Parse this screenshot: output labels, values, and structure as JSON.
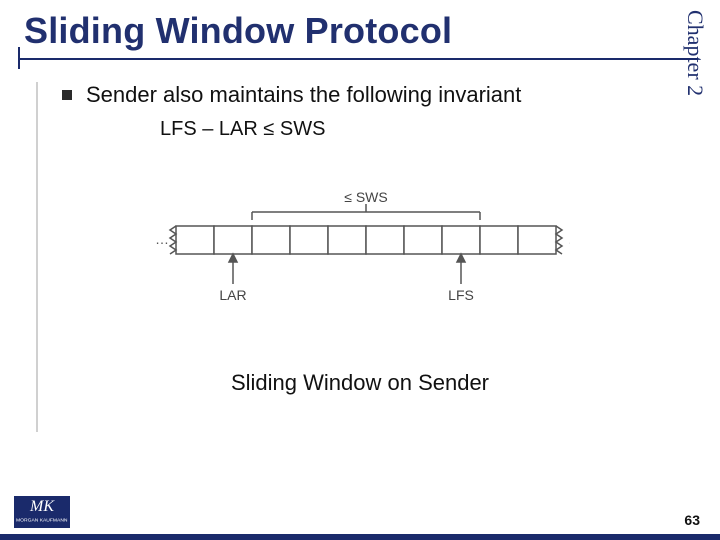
{
  "chapter": "Chapter 2",
  "title": "Sliding Window Protocol",
  "bullet": "Sender also maintains the following invariant",
  "invariant": "LFS – LAR ≤ SWS",
  "diagram": {
    "sws_label": "≤ SWS",
    "lar_label": "LAR",
    "lfs_label": "LFS",
    "ellipsis": "…"
  },
  "caption": "Sliding Window on Sender",
  "logo": {
    "mk": "MK",
    "pub": "MORGAN KAUFMANN"
  },
  "page": "63"
}
